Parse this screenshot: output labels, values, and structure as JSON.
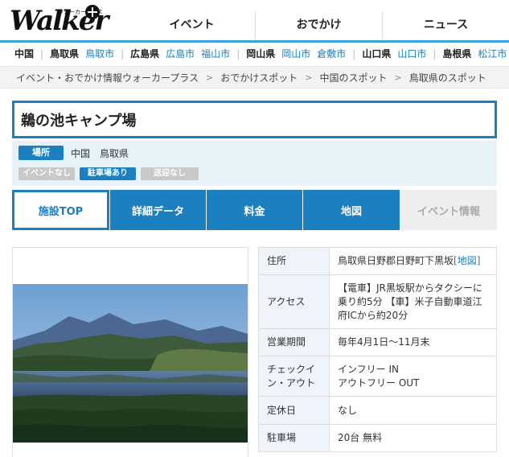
{
  "header": {
    "logo_text": "Walker",
    "logo_sub": "ウォーカープラス",
    "nav": [
      "イベント",
      "おでかけ",
      "ニュース"
    ]
  },
  "region": [
    {
      "label": "中国",
      "type": "bold"
    },
    {
      "label": "鳥取県",
      "type": "bold"
    },
    {
      "label": "鳥取市",
      "type": "link"
    },
    {
      "label": "広島県",
      "type": "bold"
    },
    {
      "label": "広島市",
      "type": "link"
    },
    {
      "label": "福山市",
      "type": "link"
    },
    {
      "label": "岡山県",
      "type": "bold"
    },
    {
      "label": "岡山市",
      "type": "link"
    },
    {
      "label": "倉敷市",
      "type": "link"
    },
    {
      "label": "山口県",
      "type": "bold"
    },
    {
      "label": "山口市",
      "type": "link"
    },
    {
      "label": "島根県",
      "type": "bold"
    },
    {
      "label": "松江市",
      "type": "link"
    }
  ],
  "breadcrumbs": [
    "イベント・おでかけ情報ウォーカープラス",
    "おでかけスポット",
    "中国のスポット",
    "鳥取県のスポット"
  ],
  "title": "鵜の池キャンプ場",
  "place": {
    "label": "場所",
    "value": "中国　鳥取県"
  },
  "tags": [
    {
      "label": "イベントなし",
      "on": false
    },
    {
      "label": "駐車場あり",
      "on": true
    },
    {
      "label": "送迎なし",
      "on": false
    }
  ],
  "tabs": [
    "施設TOP",
    "詳細データ",
    "料金",
    "地図",
    "イベント情報"
  ],
  "details": {
    "address_key": "住所",
    "address_value": "鳥取県日野郡日野町下黒坂",
    "address_map": "[地図]",
    "access_key": "アクセス",
    "access_value": "【電車】JR黒坂駅からタクシーに乗り約5分 【車】米子自動車道江府ICから約20分",
    "period_key": "営業期間",
    "period_value": "毎年4月1日〜11月末",
    "checkin_key": "チェックイン・アウト",
    "checkin_in": "インフリー IN",
    "checkin_out": "アウトフリー OUT",
    "closed_key": "定休日",
    "closed_value": "なし",
    "parking_key": "駐車場",
    "parking_value": "20台 無料"
  },
  "colors": {
    "accent": "#1b7fc0",
    "nav_bar": "#3aa3d8",
    "info_bg": "#e6f1f8"
  }
}
